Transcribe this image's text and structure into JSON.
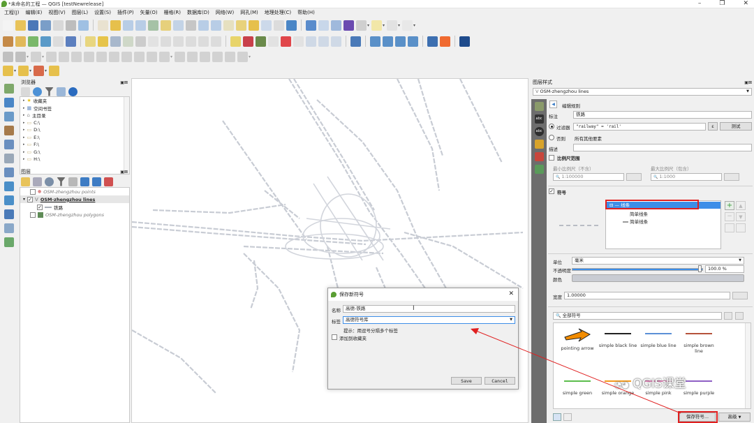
{
  "window": {
    "title": "*未命名的工程 — QGIS [testNewrelease]",
    "min": "–",
    "max": "❐",
    "close": "✕"
  },
  "menubar": [
    "工程(J)",
    "编辑(E)",
    "视图(V)",
    "图层(L)",
    "设置(S)",
    "插件(P)",
    "矢量(O)",
    "栅格(R)",
    "数据库(D)",
    "网络(W)",
    "网孔(M)",
    "地理处理(C)",
    "帮助(H)"
  ],
  "browser": {
    "title": "浏览器",
    "items": [
      "收藏夹",
      "空间书签",
      "主目录",
      "C:\\",
      "D:\\",
      "E:\\",
      "F:\\",
      "G:\\",
      "H:\\"
    ]
  },
  "layers": {
    "title": "图层",
    "items": [
      {
        "name": "OSM-zhengzhou points",
        "checked": false,
        "bold": false
      },
      {
        "name": "OSM-zhengzhou lines",
        "checked": true,
        "bold": true
      },
      {
        "name": "铁路",
        "checked": true,
        "bold": false
      },
      {
        "name": "OSM-zhengzhou polygons",
        "checked": false,
        "bold": false
      }
    ]
  },
  "style_panel": {
    "title": "图层样式",
    "layer_select": "OSM-zhengzhou lines",
    "edit_rule": "编辑规则",
    "label_caption": "标注",
    "label_value": "铁路",
    "filter_caption": "过滤器",
    "filter_value": "\"railway\" = 'rail'",
    "filter_btn": "ε",
    "test_btn": "测试",
    "else_caption": "否则",
    "else_text": "所有其他要素",
    "desc_caption": "描述",
    "scale_caption": "比例尺范围",
    "min_scale_caption": "最小比例尺（不含）",
    "max_scale_caption": "最大比例尺（包含）",
    "min_scale_value": "1:100000",
    "max_scale_value": "1:1000",
    "symbol_caption": "符号",
    "symbol_tree": [
      "线条",
      "简单线条",
      "简单线条"
    ],
    "unit_caption": "单位",
    "unit_value": "毫米",
    "opacity_caption": "不透明度",
    "opacity_value": "100.0 %",
    "opacity_fraction": 1.0,
    "color_caption": "颜色",
    "width_caption": "宽度",
    "width_value": "1.00000",
    "search_value": "全部符号",
    "library": [
      {
        "label": "pointing arrow",
        "color": "#f28c00"
      },
      {
        "label": "simple black line",
        "color": "#222222"
      },
      {
        "label": "simple blue line",
        "color": "#5b8fd6"
      },
      {
        "label": "simple brown line",
        "color": "#b5523b"
      },
      {
        "label": "simple green",
        "color": "#5bbd4c"
      },
      {
        "label": "simple orange",
        "color": "#f39a1d"
      },
      {
        "label": "simple pink",
        "color": "#e07ab3"
      },
      {
        "label": "simple purple",
        "color": "#8e5fc4"
      }
    ],
    "save_symbol_btn": "保存符号...",
    "advanced_btn": "高级"
  },
  "dialog": {
    "title": "保存新符号",
    "name_caption": "名称",
    "name_value": "高德-铁路",
    "tag_caption": "标签",
    "tag_value": "高德符号库",
    "hint": "提示：用逗号分隔多个标签",
    "favorite_label": "添加到收藏夹",
    "save_btn": "Save",
    "cancel_btn": "Cancel"
  },
  "watermark": "QGIS课堂",
  "colors": {
    "highlight": "#e02020",
    "selected": "#3d8ee8",
    "accent": "#5a9e33"
  }
}
